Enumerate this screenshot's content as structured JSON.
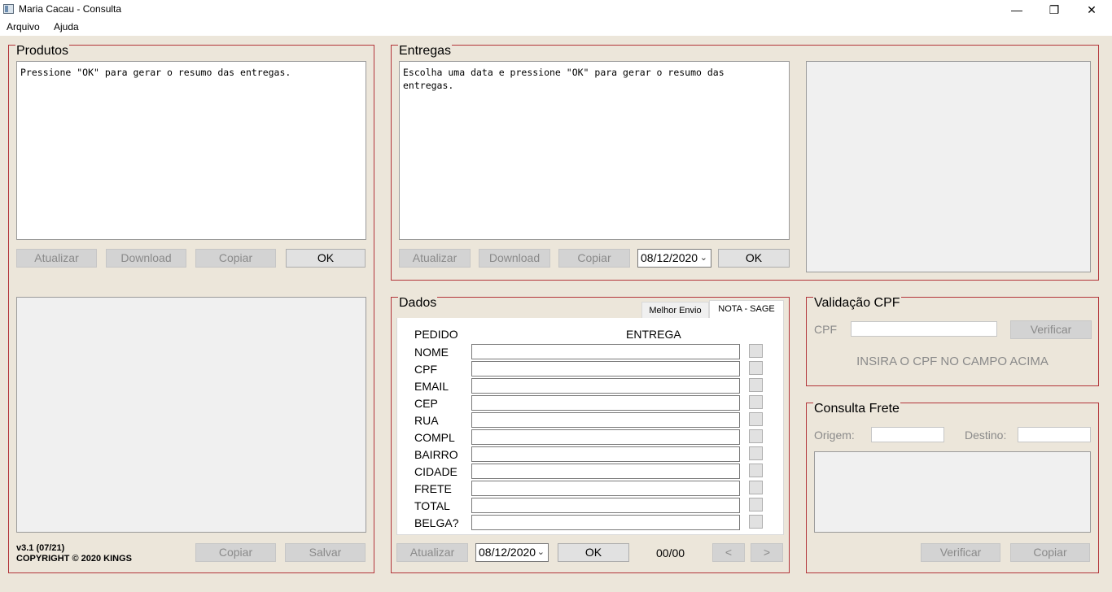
{
  "window": {
    "title": "Maria Cacau - Consulta"
  },
  "menu": [
    "Arquivo",
    "Ajuda"
  ],
  "produtos": {
    "title": "Produtos",
    "text": "Pressione \"OK\" para gerar o resumo das entregas.",
    "buttons": [
      "Atualizar",
      "Download",
      "Copiar",
      "OK"
    ],
    "version": "v3.1 (07/21)",
    "copyright": "COPYRIGHT © 2020 KINGS",
    "bottom_buttons": [
      "Copiar",
      "Salvar"
    ]
  },
  "entregas": {
    "title": "Entregas",
    "text": "Escolha uma data e pressione \"OK\" para gerar o resumo das\nentregas.",
    "buttons": [
      "Atualizar",
      "Download",
      "Copiar"
    ],
    "date": "08/12/2020",
    "ok": "OK"
  },
  "dados": {
    "title": "Dados",
    "tabs": [
      "Melhor Envio",
      "NOTA - SAGE"
    ],
    "pedido_label": "PEDIDO",
    "entrega_label": "ENTREGA",
    "fields": [
      "NOME",
      "CPF",
      "EMAIL",
      "CEP",
      "RUA",
      "COMPL",
      "BAIRRO",
      "CIDADE",
      "FRETE",
      "TOTAL",
      "BELGA?"
    ],
    "atualizar": "Atualizar",
    "date": "08/12/2020",
    "ok": "OK",
    "counter": "00/00",
    "prev": "<",
    "next": ">"
  },
  "cpf": {
    "title": "Validação CPF",
    "label": "CPF",
    "button": "Verificar",
    "message": "INSIRA O CPF NO CAMPO ACIMA"
  },
  "frete": {
    "title": "Consulta Frete",
    "origem": "Origem:",
    "destino": "Destino:",
    "buttons": [
      "Verificar",
      "Copiar"
    ]
  }
}
